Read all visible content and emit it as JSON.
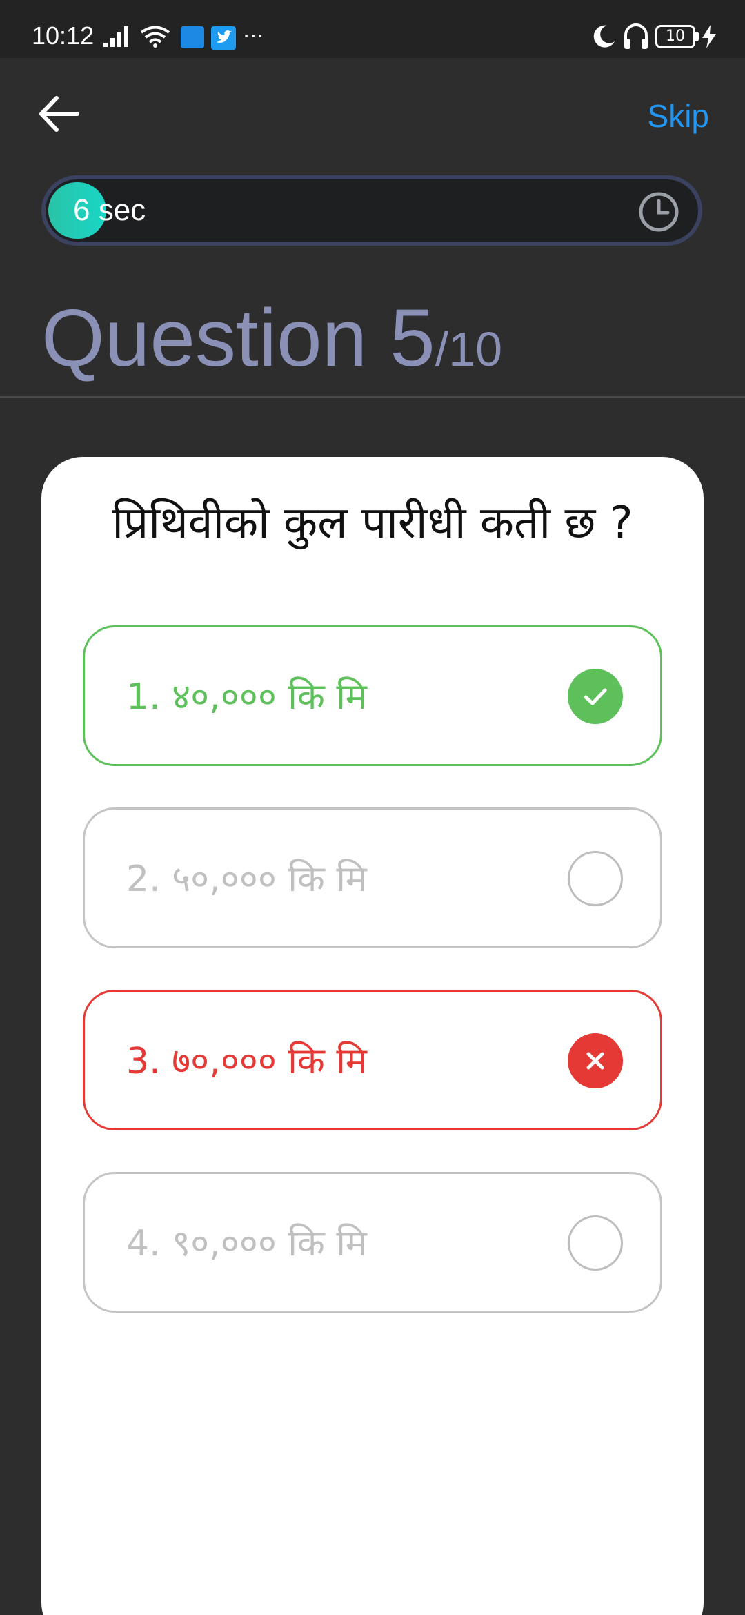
{
  "status_bar": {
    "time": "10:12",
    "dots": "···",
    "battery": "10"
  },
  "header": {
    "skip_label": "Skip"
  },
  "timer": {
    "text": "6 sec",
    "progress_fraction": 0.09
  },
  "question_header": {
    "prefix": "Question 5",
    "total": "/10"
  },
  "question": {
    "text": "प्रिथिवीको कुल पारीधी कती छ ?",
    "options": [
      {
        "label": "1. ४०,००० कि मि",
        "state": "correct"
      },
      {
        "label": "2. ५०,००० कि मि",
        "state": "neutral"
      },
      {
        "label": "3. ७०,००० कि मि",
        "state": "wrong"
      },
      {
        "label": "4. ९०,००० कि मि",
        "state": "neutral"
      }
    ]
  },
  "colors": {
    "accent_blue": "#2196f3",
    "correct_green": "#5ec05a",
    "wrong_red": "#e53935",
    "timer_teal": "#1ad6c6",
    "title_lavender": "#8a90b6"
  }
}
